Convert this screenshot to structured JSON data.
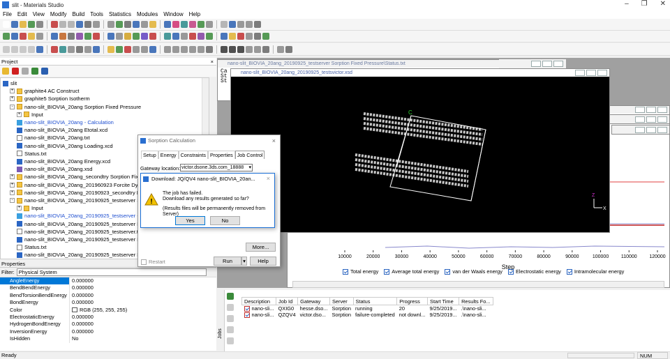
{
  "app": {
    "title": "slit - Materials Studio"
  },
  "menu": [
    "File",
    "Edit",
    "View",
    "Modify",
    "Build",
    "Tools",
    "Statistics",
    "Modules",
    "Window",
    "Help"
  ],
  "project": {
    "title": "Project",
    "tree": [
      {
        "label": "slit",
        "kind": "root",
        "indent": 0
      },
      {
        "label": "graphite4 AC Construct",
        "kind": "folder",
        "indent": 1,
        "exp": "+"
      },
      {
        "label": "graphite5 Sorption Isotherm",
        "kind": "folder",
        "indent": 1,
        "exp": "+"
      },
      {
        "label": "nano-slit_BIOVIA_20ang Sorption Fixed Pressure",
        "kind": "folder",
        "indent": 1,
        "exp": "-"
      },
      {
        "label": "Input",
        "kind": "folder",
        "indent": 2,
        "exp": "+"
      },
      {
        "label": "nano-slit_BIOVIA_20ang - Calculation",
        "kind": "calc",
        "indent": 2,
        "color": "#1f4fd0"
      },
      {
        "label": "nano-slit_BIOVIA_20ang Etotal.xcd",
        "kind": "chart",
        "indent": 2
      },
      {
        "label": "nano-slit_BIOVIA_20ang.txt",
        "kind": "doc",
        "indent": 2
      },
      {
        "label": "nano-slit_BIOVIA_20ang Loading.xcd",
        "kind": "chart",
        "indent": 2
      },
      {
        "label": "Status.txt",
        "kind": "doc",
        "indent": 2
      },
      {
        "label": "nano-slit_BIOVIA_20ang Energy.xcd",
        "kind": "chart",
        "indent": 2
      },
      {
        "label": "nano-slit_BIOVIA_20ang.xsd",
        "kind": "struct",
        "indent": 2
      },
      {
        "label": "nano-slit_BIOVIA_20ang_secondtry Sorption Fixed Pr",
        "kind": "folder",
        "indent": 1,
        "exp": "+"
      },
      {
        "label": "nano-slit_BIOVIA_20ang_201960923 Forcite Dynam",
        "kind": "folder",
        "indent": 1,
        "exp": "+"
      },
      {
        "label": "nano-slit_BIOVIA_20ang_20190923_secondtry Forc",
        "kind": "folder",
        "indent": 1,
        "exp": "+"
      },
      {
        "label": "nano-slit_BIOVIA_20ang_20190925_testserver Sorpt",
        "kind": "folder",
        "indent": 1,
        "exp": "-"
      },
      {
        "label": "Input",
        "kind": "folder",
        "indent": 2,
        "exp": "+"
      },
      {
        "label": "nano-slit_BIOVIA_20ang_20190925_testserver - Ca",
        "kind": "calc",
        "indent": 2,
        "color": "#1f4fd0"
      },
      {
        "label": "nano-slit_BIOVIA_20ang_20190925_testserver Et",
        "kind": "chart",
        "indent": 2
      },
      {
        "label": "nano-slit_BIOVIA_20ang_20190925_testserver.txt",
        "kind": "doc",
        "indent": 2
      },
      {
        "label": "nano-slit_BIOVIA_20ang_20190925_testserver Lo",
        "kind": "chart",
        "indent": 2
      },
      {
        "label": "Status.txt",
        "kind": "doc",
        "indent": 2
      },
      {
        "label": "nano-slit_BIOVIA_20ang_20190925_testserver En",
        "kind": "chart",
        "indent": 2
      }
    ]
  },
  "properties": {
    "title": "Properties",
    "filter_label": "Filter:",
    "filter_value": "Physical System",
    "rows": [
      {
        "k": "AngleEnergy",
        "v": "0.000000"
      },
      {
        "k": "BendBendEnergy",
        "v": "0.000000"
      },
      {
        "k": "BendTorsionBendEnergy",
        "v": "0.000000"
      },
      {
        "k": "BondEnergy",
        "v": "0.000000"
      },
      {
        "k": "Color",
        "v": "RGB (255, 255, 255)"
      },
      {
        "k": "ElectrostaticEnergy",
        "v": "0.000000"
      },
      {
        "k": "HydrogenBondEnergy",
        "v": "0.000000"
      },
      {
        "k": "InversionEnergy",
        "v": "0.000000"
      },
      {
        "k": "IsHidden",
        "v": "No"
      }
    ]
  },
  "windows": {
    "status": {
      "title": "nano-slit_BIOVIA_20ang_20190925_testserver Sorption Fixed Pressure\\Status.txt",
      "lines": [
        "Ca",
        "St",
        "St"
      ]
    },
    "xsd": {
      "title": "nano-slit_BIOVIA_20ang_20190925_testsvictor.xsd",
      "axis_c": "C",
      "axis_z": "Z",
      "axis_x": "X"
    }
  },
  "chart_data": {
    "type": "line",
    "x_ticks": [
      "10000",
      "20000",
      "30000",
      "40000",
      "50000",
      "60000",
      "70000",
      "80000",
      "90000",
      "100000",
      "110000",
      "120000"
    ],
    "xlabel": "Step",
    "series": [
      {
        "name": "Total energy"
      },
      {
        "name": "Average total energy"
      },
      {
        "name": "van der Waals energy"
      },
      {
        "name": "Electrostatic energy"
      },
      {
        "name": "Intramolecular energy"
      }
    ]
  },
  "sorption": {
    "title": "Sorption Calculation",
    "tabs": [
      "Setup",
      "Energy",
      "Constraints",
      "Properties",
      "Job Control"
    ],
    "gateway_label": "Gateway location:",
    "gateway_value": "victor.dsone.3ds.com_18888",
    "more": "More...",
    "restart": "Restart",
    "run": "Run",
    "help": "Help"
  },
  "download": {
    "title": "Download: JQ/QV4 nano-slit_BIOVIA_20an...",
    "msg1": "The job has failed.",
    "msg2": "Download any results generated so far?",
    "msg3": "(Results files will be permanently removed from Server)",
    "yes": "Yes",
    "no": "No"
  },
  "jobs": {
    "side": "Jobs",
    "columns": [
      "Description",
      "Job Id",
      "Gateway",
      "Server",
      "Status",
      "Progress",
      "Start Time",
      "Results Fo..."
    ],
    "rows": [
      [
        "nano-sli...",
        "QXIG0",
        "hesse.dso...",
        "Sorption",
        "running",
        "20",
        "9/25/2019...",
        ".\\nano-sli..."
      ],
      [
        "nano-sli...",
        "QZQV4",
        "victor.dso...",
        "Sorption",
        "failure-completed",
        "not downl...",
        "9/25/2019...",
        ".\\nano-sli..."
      ]
    ]
  },
  "status": {
    "ready": "Ready",
    "num": "NUM"
  }
}
